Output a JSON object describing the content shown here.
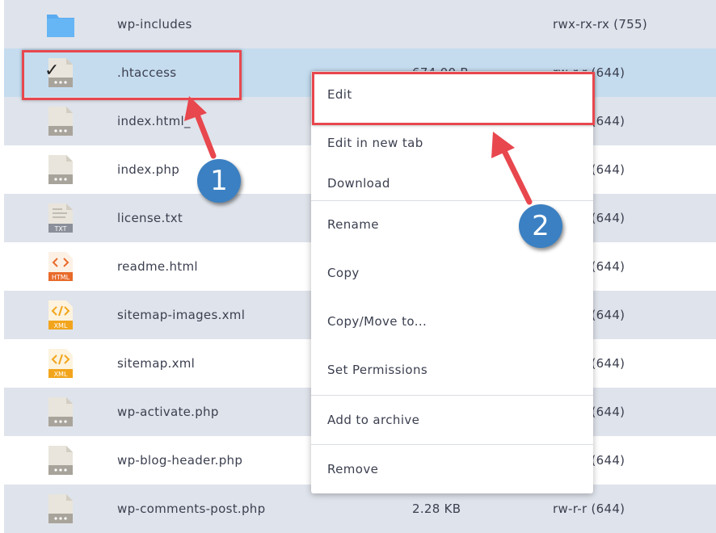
{
  "files": [
    {
      "name": "wp-includes",
      "size": "",
      "perm": "rwx-rx-rx (755)",
      "icon": "folder-icon"
    },
    {
      "name": ".htaccess",
      "size": "674.00 B",
      "perm": "rw-r-r (644)",
      "icon": "file-icon",
      "checked": true
    },
    {
      "name": "index.html_",
      "size": "",
      "perm": "rw-r-r (644)",
      "icon": "file-icon"
    },
    {
      "name": "index.php",
      "size": "",
      "perm": "rw-r-r (644)",
      "icon": "file-icon"
    },
    {
      "name": "license.txt",
      "size": "",
      "perm": "rw-r-r (644)",
      "icon": "txt-file-icon",
      "badge": "TXT"
    },
    {
      "name": "readme.html",
      "size": "",
      "perm": "rw-r-r (644)",
      "icon": "html-file-icon",
      "badge": "HTML"
    },
    {
      "name": "sitemap-images.xml",
      "size": "",
      "perm": "rw-r-r (644)",
      "icon": "xml-file-icon",
      "badge": "XML"
    },
    {
      "name": "sitemap.xml",
      "size": "",
      "perm": "rw-r-r (644)",
      "icon": "xml-file-icon",
      "badge": "XML"
    },
    {
      "name": "wp-activate.php",
      "size": "",
      "perm": "rw-r-r (644)",
      "icon": "file-icon"
    },
    {
      "name": "wp-blog-header.php",
      "size": "",
      "perm": "rw-r-r (644)",
      "icon": "file-icon"
    },
    {
      "name": "wp-comments-post.php",
      "size": "2.28 KB",
      "perm": "rw-r-r (644)",
      "icon": "file-icon"
    }
  ],
  "menu": {
    "edit": "Edit",
    "edit_new_tab": "Edit in new tab",
    "download": "Download",
    "rename": "Rename",
    "copy": "Copy",
    "copy_move": "Copy/Move to...",
    "set_permissions": "Set Permissions",
    "add_archive": "Add to archive",
    "remove": "Remove"
  },
  "annotations": {
    "step1": "1",
    "step2": "2",
    "color": "#e8474e",
    "badge_color": "#3b80c2"
  },
  "colors": {
    "row_alt": "#dfe3eb",
    "row_selected": "#c5dcef",
    "folder": "#5aabf0",
    "html_badge": "#e86a2a",
    "xml_badge": "#f2a51c",
    "txt_badge": "#8a8f99"
  }
}
